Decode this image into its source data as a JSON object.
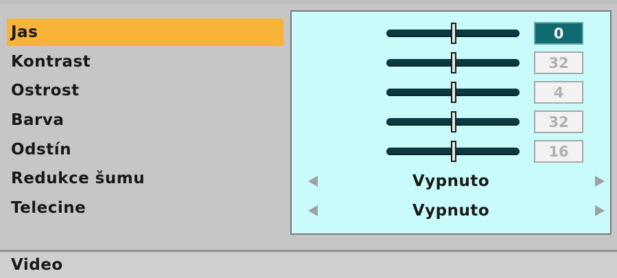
{
  "menu": {
    "items": [
      {
        "label": "Jas",
        "selected": true
      },
      {
        "label": "Kontrast",
        "selected": false
      },
      {
        "label": "Ostrost",
        "selected": false
      },
      {
        "label": "Barva",
        "selected": false
      },
      {
        "label": "Odstín",
        "selected": false
      },
      {
        "label": "Redukce šumu",
        "selected": false
      },
      {
        "label": "Telecine",
        "selected": false
      }
    ]
  },
  "controls": {
    "brightness_value": "0",
    "contrast_value": "32",
    "sharpness_value": "4",
    "color_value": "32",
    "hue_value": "16",
    "noise_reduction_value": "Vypnuto",
    "telecine_value": "Vypnuto"
  },
  "footer": {
    "section_name": "Video"
  },
  "colors": {
    "selection": "#f8b338",
    "panel_bg": "#c9fbfb",
    "active_value_bg": "#0e6b70",
    "slider_track": "#0a3a40"
  },
  "icons": [
    "slider-thumb-icon",
    "arrow-left-icon",
    "arrow-right-icon"
  ]
}
